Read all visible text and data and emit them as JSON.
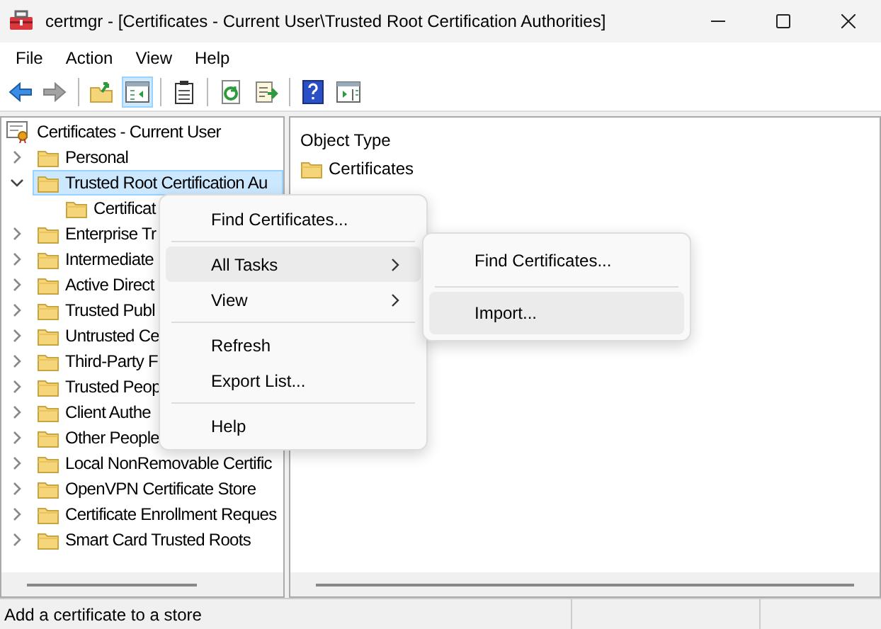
{
  "window": {
    "title": "certmgr - [Certificates - Current User\\Trusted Root Certification Authorities]"
  },
  "menu_bar": [
    "File",
    "Action",
    "View",
    "Help"
  ],
  "toolbar": [
    {
      "kind": "back",
      "disabled": false,
      "pressed": false
    },
    {
      "kind": "forward",
      "disabled": true,
      "pressed": false
    },
    {
      "kind": "separator"
    },
    {
      "kind": "up",
      "disabled": false,
      "pressed": false
    },
    {
      "kind": "tree",
      "disabled": false,
      "pressed": true
    },
    {
      "kind": "separator"
    },
    {
      "kind": "clipboard",
      "disabled": false,
      "pressed": false
    },
    {
      "kind": "separator"
    },
    {
      "kind": "refresh",
      "disabled": false,
      "pressed": false
    },
    {
      "kind": "export",
      "disabled": false,
      "pressed": false
    },
    {
      "kind": "separator"
    },
    {
      "kind": "help",
      "disabled": false,
      "pressed": false
    },
    {
      "kind": "panel",
      "disabled": false,
      "pressed": false
    }
  ],
  "tree": {
    "label": "Certificates - Current User",
    "children": [
      {
        "label": "Personal",
        "expanded": false,
        "selected": false
      },
      {
        "label": "Trusted Root Certification Au",
        "expanded": true,
        "selected": true,
        "children": [
          {
            "label": "Certificat",
            "selected": false
          }
        ]
      },
      {
        "label": "Enterprise Tr",
        "expanded": false,
        "selected": false
      },
      {
        "label": "Intermediate",
        "expanded": false,
        "selected": false
      },
      {
        "label": "Active Direct",
        "expanded": false,
        "selected": false
      },
      {
        "label": "Trusted Publ",
        "expanded": false,
        "selected": false
      },
      {
        "label": "Untrusted Ce",
        "expanded": false,
        "selected": false
      },
      {
        "label": "Third-Party F",
        "expanded": false,
        "selected": false
      },
      {
        "label": "Trusted Peop",
        "expanded": false,
        "selected": false
      },
      {
        "label": "Client Authe",
        "expanded": false,
        "selected": false
      },
      {
        "label": "Other People",
        "expanded": false,
        "selected": false
      },
      {
        "label": "Local NonRemovable Certific",
        "expanded": false,
        "selected": false
      },
      {
        "label": "OpenVPN Certificate Store",
        "expanded": false,
        "selected": false
      },
      {
        "label": "Certificate Enrollment Reques",
        "expanded": false,
        "selected": false
      },
      {
        "label": "Smart Card Trusted Roots",
        "expanded": false,
        "selected": false
      }
    ]
  },
  "list": {
    "columns": [
      "Object Type"
    ],
    "rows": [
      {
        "label": "Certificates"
      }
    ]
  },
  "context_menu": [
    {
      "kind": "item",
      "label": "Find Certificates...",
      "submenu": false,
      "selected": false
    },
    {
      "kind": "separator"
    },
    {
      "kind": "item",
      "label": "All Tasks",
      "submenu": true,
      "selected": true
    },
    {
      "kind": "item",
      "label": "View",
      "submenu": true,
      "selected": false
    },
    {
      "kind": "separator"
    },
    {
      "kind": "item",
      "label": "Refresh",
      "submenu": false,
      "selected": false
    },
    {
      "kind": "item",
      "label": "Export List...",
      "submenu": false,
      "selected": false
    },
    {
      "kind": "separator"
    },
    {
      "kind": "item",
      "label": "Help",
      "submenu": false,
      "selected": false
    }
  ],
  "submenu": [
    {
      "kind": "item",
      "label": "Find Certificates...",
      "selected": false
    },
    {
      "kind": "separator"
    },
    {
      "kind": "item",
      "label": "Import...",
      "selected": true
    }
  ],
  "status_bar": {
    "text": "Add a certificate to a store"
  }
}
